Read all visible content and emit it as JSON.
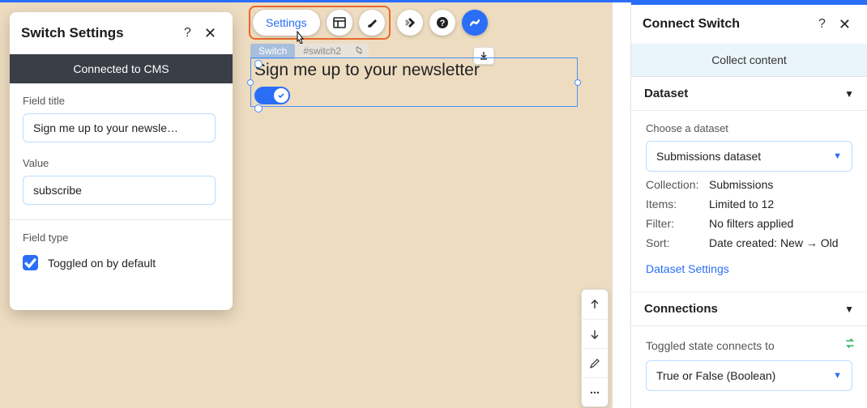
{
  "colors": {
    "accent": "#2a6ef7",
    "highlight": "#e9672a"
  },
  "toolbar": {
    "settings_label": "Settings"
  },
  "element_tag": {
    "type": "Switch",
    "id": "#switch2"
  },
  "canvas": {
    "switch_label": "Sign me up to your newsletter"
  },
  "left_panel": {
    "title": "Switch Settings",
    "connected_banner": "Connected to CMS",
    "field_title_label": "Field title",
    "field_title_value": "Sign me up to your newsle…",
    "value_label": "Value",
    "value_value": "subscribe",
    "field_type_label": "Field type",
    "toggle_default_label": "Toggled on by default",
    "toggle_default_checked": true
  },
  "right_panel": {
    "title": "Connect Switch",
    "collect_banner": "Collect content",
    "dataset_section_title": "Dataset",
    "choose_dataset_label": "Choose a dataset",
    "selected_dataset": "Submissions dataset",
    "meta": {
      "collection_k": "Collection:",
      "collection_v": "Submissions",
      "items_k": "Items:",
      "items_v": "Limited to 12",
      "filter_k": "Filter:",
      "filter_v": "No filters applied",
      "sort_k": "Sort:",
      "sort_v": "Date created: New → Old"
    },
    "dataset_settings_link": "Dataset Settings",
    "connections_section_title": "Connections",
    "toggled_state_label": "Toggled state connects to",
    "toggled_state_value": "True or False (Boolean)"
  }
}
